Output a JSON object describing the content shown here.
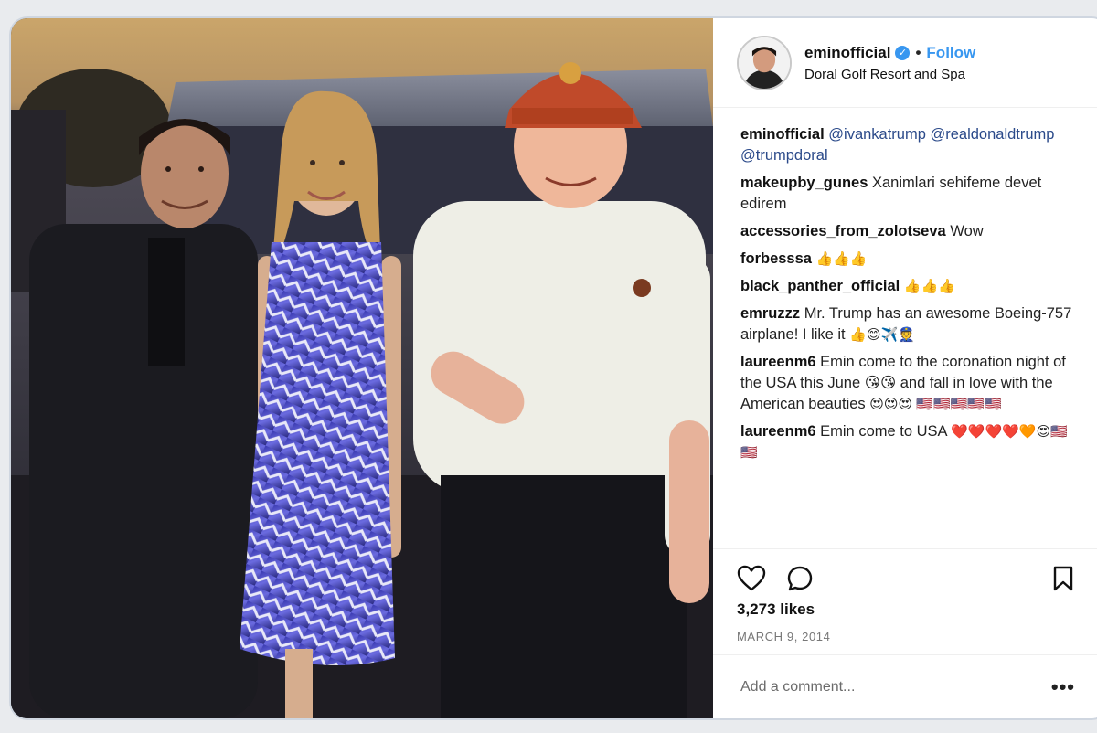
{
  "post": {
    "username": "eminofficial",
    "verified_icon": "verified-badge-icon",
    "follow_label": "Follow",
    "location": "Doral Golf Resort and Spa",
    "comments": [
      {
        "user": "eminofficial",
        "text": "@ivankatrump @realdonaldtrump @trumpdoral",
        "emoji": ""
      },
      {
        "user": "makeupby_gunes",
        "text": "Xanimlari sehifeme devet edirem",
        "emoji": ""
      },
      {
        "user": "accessories_from_zolotseva",
        "text": "Wow",
        "emoji": ""
      },
      {
        "user": "forbesssa",
        "text": "",
        "emoji": "👍👍👍"
      },
      {
        "user": "black_panther_official",
        "text": "",
        "emoji": "👍👍👍"
      },
      {
        "user": "emruzzz",
        "text": "Mr. Trump has an awesome Boeing-757 airplane! I like it",
        "emoji": "👍😊✈️👮"
      },
      {
        "user": "laureenm6",
        "text": "Emin come to the coronation night of the USA this June 😘😘 and fall in love with the American beauties",
        "emoji": "😍😍😍 🇺🇸🇺🇸🇺🇸🇺🇸🇺🇸"
      },
      {
        "user": "laureenm6",
        "text": "Emin come to USA",
        "emoji": "❤️❤️❤️❤️🧡😍🇺🇸🇺🇸"
      }
    ],
    "likes": "3,273 likes",
    "date": "MARCH 9, 2014",
    "comment_placeholder": "Add a comment...",
    "more_label": "•••"
  },
  "icons": {
    "heart": "heart-outline-icon",
    "comment": "comment-bubble-icon",
    "bookmark": "bookmark-icon"
  },
  "colors": {
    "accent": "#3897f0",
    "mention": "#2b4a8a"
  }
}
